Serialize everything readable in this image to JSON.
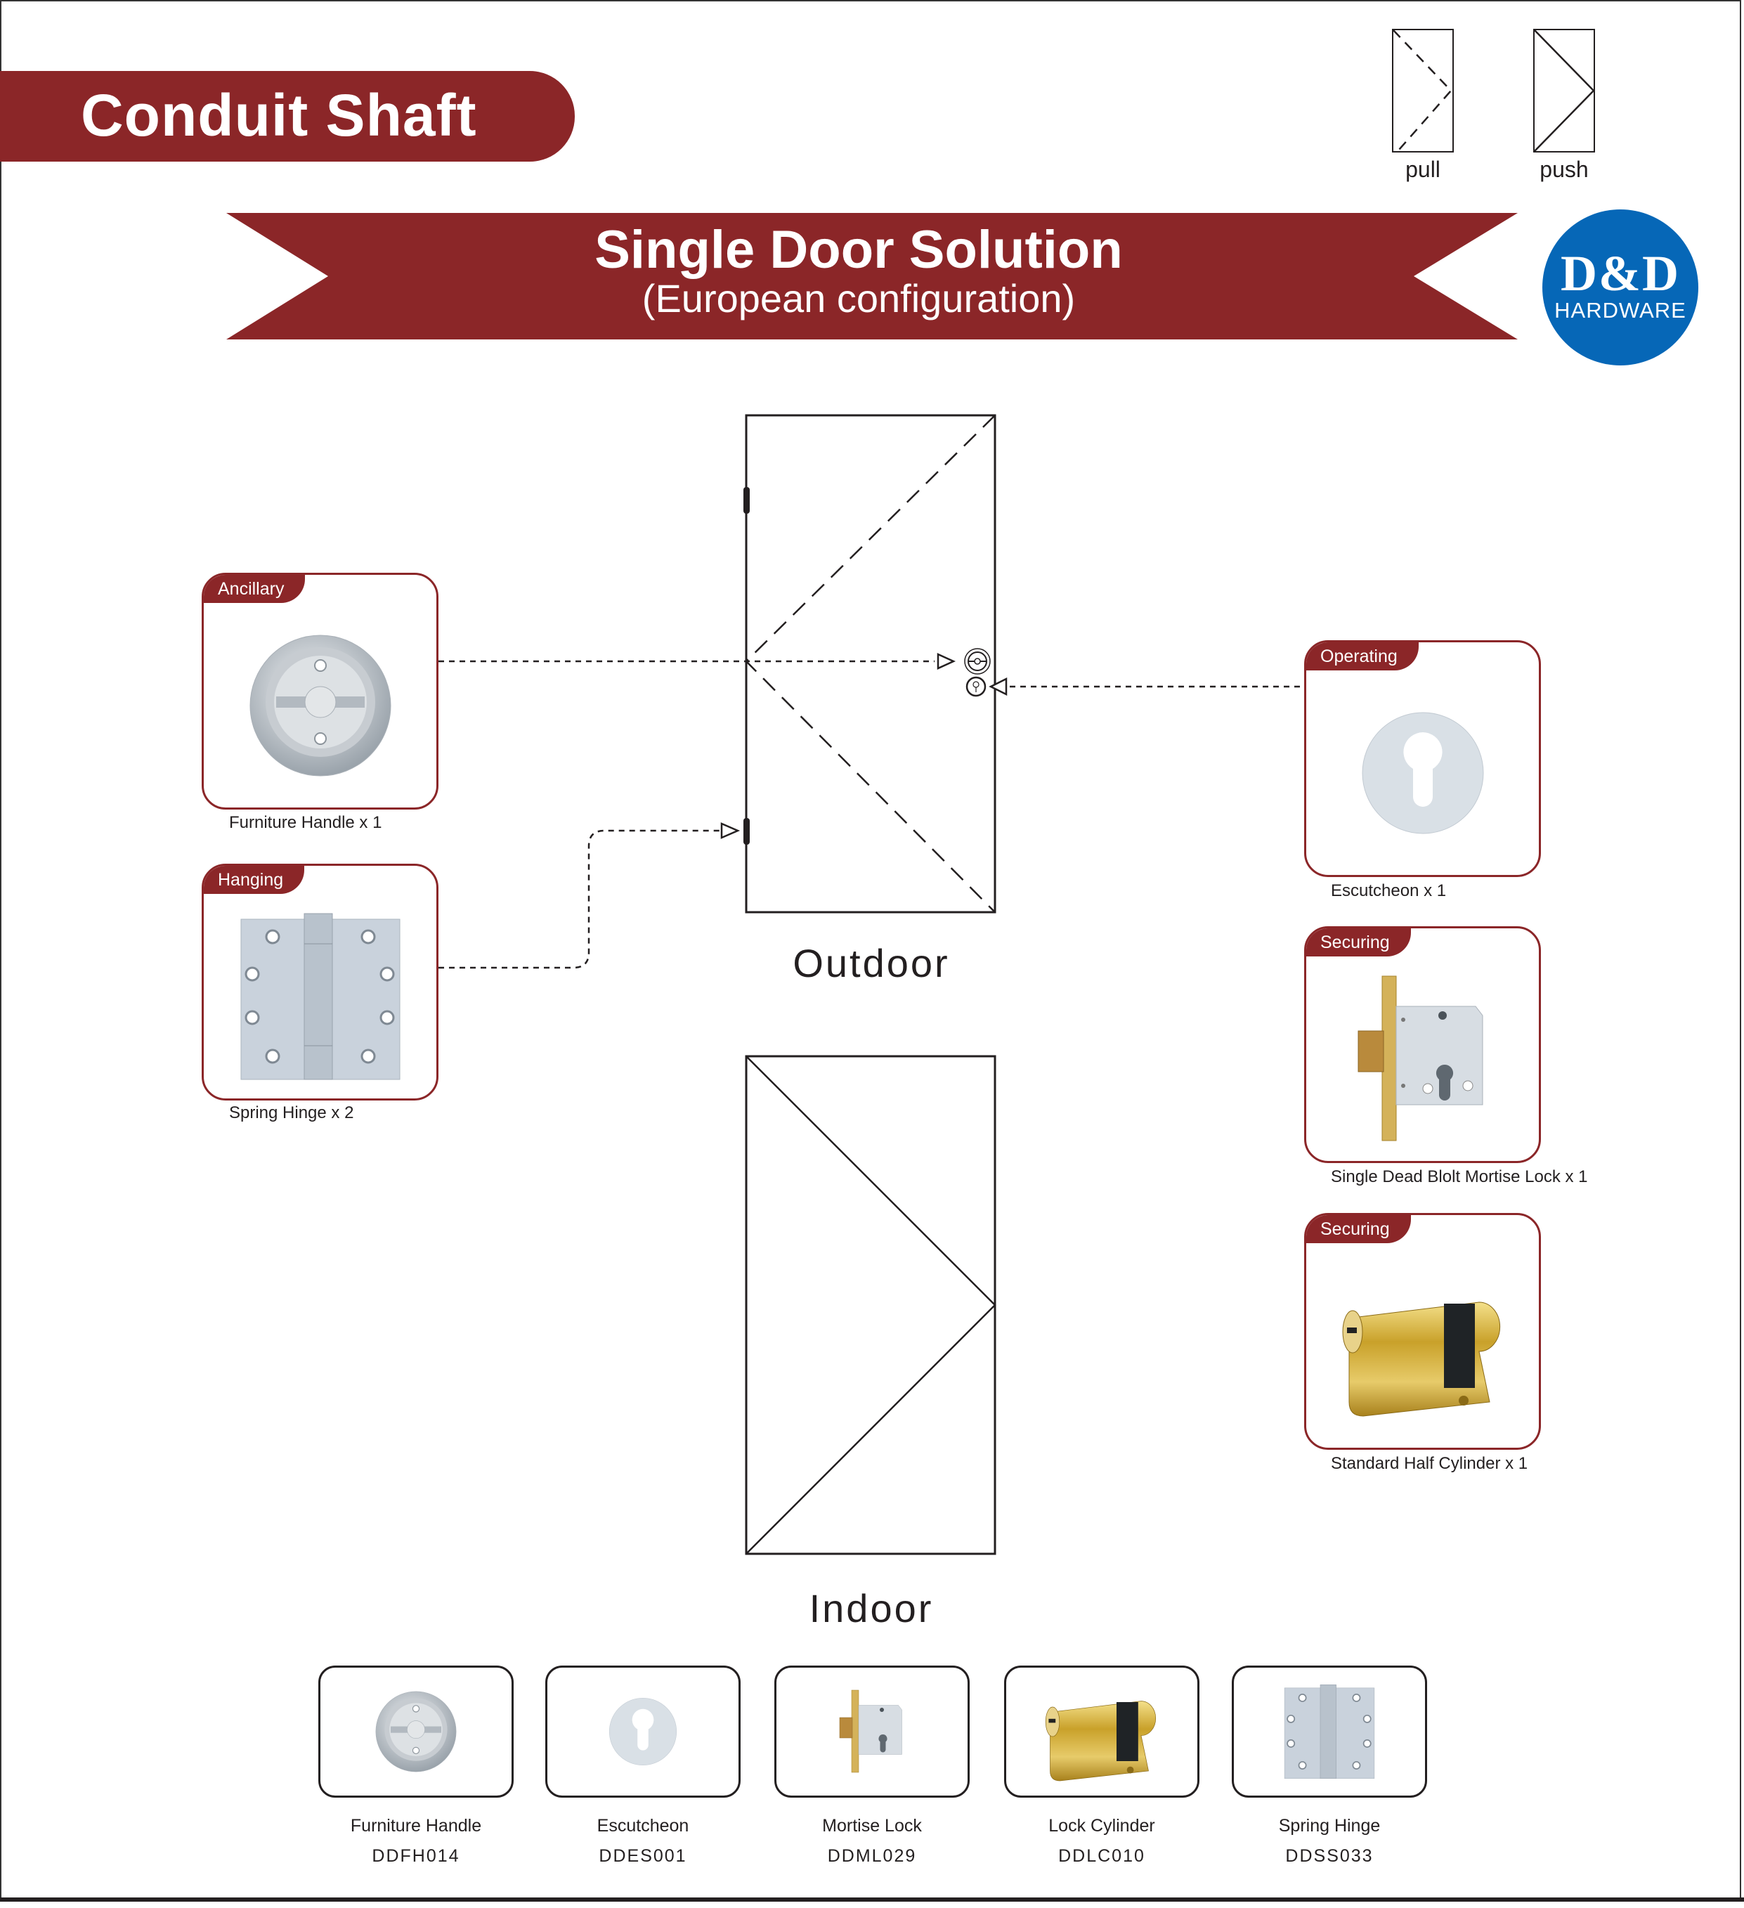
{
  "header": {
    "section_title": "Conduit Shaft",
    "legend": [
      {
        "label": "pull",
        "icon": "pull-door-icon"
      },
      {
        "label": "push",
        "icon": "push-door-icon"
      }
    ]
  },
  "banner": {
    "title": "Single Door Solution",
    "subtitle": "(European configuration)"
  },
  "logo": {
    "brand": "D&D",
    "sub": "HARDWARE",
    "color": "#0667b7"
  },
  "colors": {
    "accent": "#8b2628",
    "line": "#231f20"
  },
  "diagram": {
    "outdoor_label": "Outdoor",
    "indoor_label": "Indoor"
  },
  "components_left": [
    {
      "category": "Ancillary",
      "caption": "Furniture Handle x 1",
      "icon": "furniture-handle-icon"
    },
    {
      "category": "Hanging",
      "caption": "Spring Hinge x 2",
      "icon": "spring-hinge-icon"
    }
  ],
  "components_right": [
    {
      "category": "Operating",
      "caption": "Escutcheon x 1",
      "icon": "escutcheon-icon"
    },
    {
      "category": "Securing",
      "caption": "Single Dead Blolt Mortise Lock x 1",
      "icon": "mortise-lock-icon"
    },
    {
      "category": "Securing",
      "caption": "Standard Half Cylinder x 1",
      "icon": "half-cylinder-icon"
    }
  ],
  "catalog": [
    {
      "name": "Furniture Handle",
      "code": "DDFH014",
      "icon": "furniture-handle-icon"
    },
    {
      "name": "Escutcheon",
      "code": "DDES001",
      "icon": "escutcheon-icon"
    },
    {
      "name": "Mortise Lock",
      "code": "DDML029",
      "icon": "mortise-lock-icon"
    },
    {
      "name": "Lock Cylinder",
      "code": "DDLC010",
      "icon": "lock-cylinder-icon"
    },
    {
      "name": "Spring Hinge",
      "code": "DDSS033",
      "icon": "spring-hinge-icon"
    }
  ]
}
